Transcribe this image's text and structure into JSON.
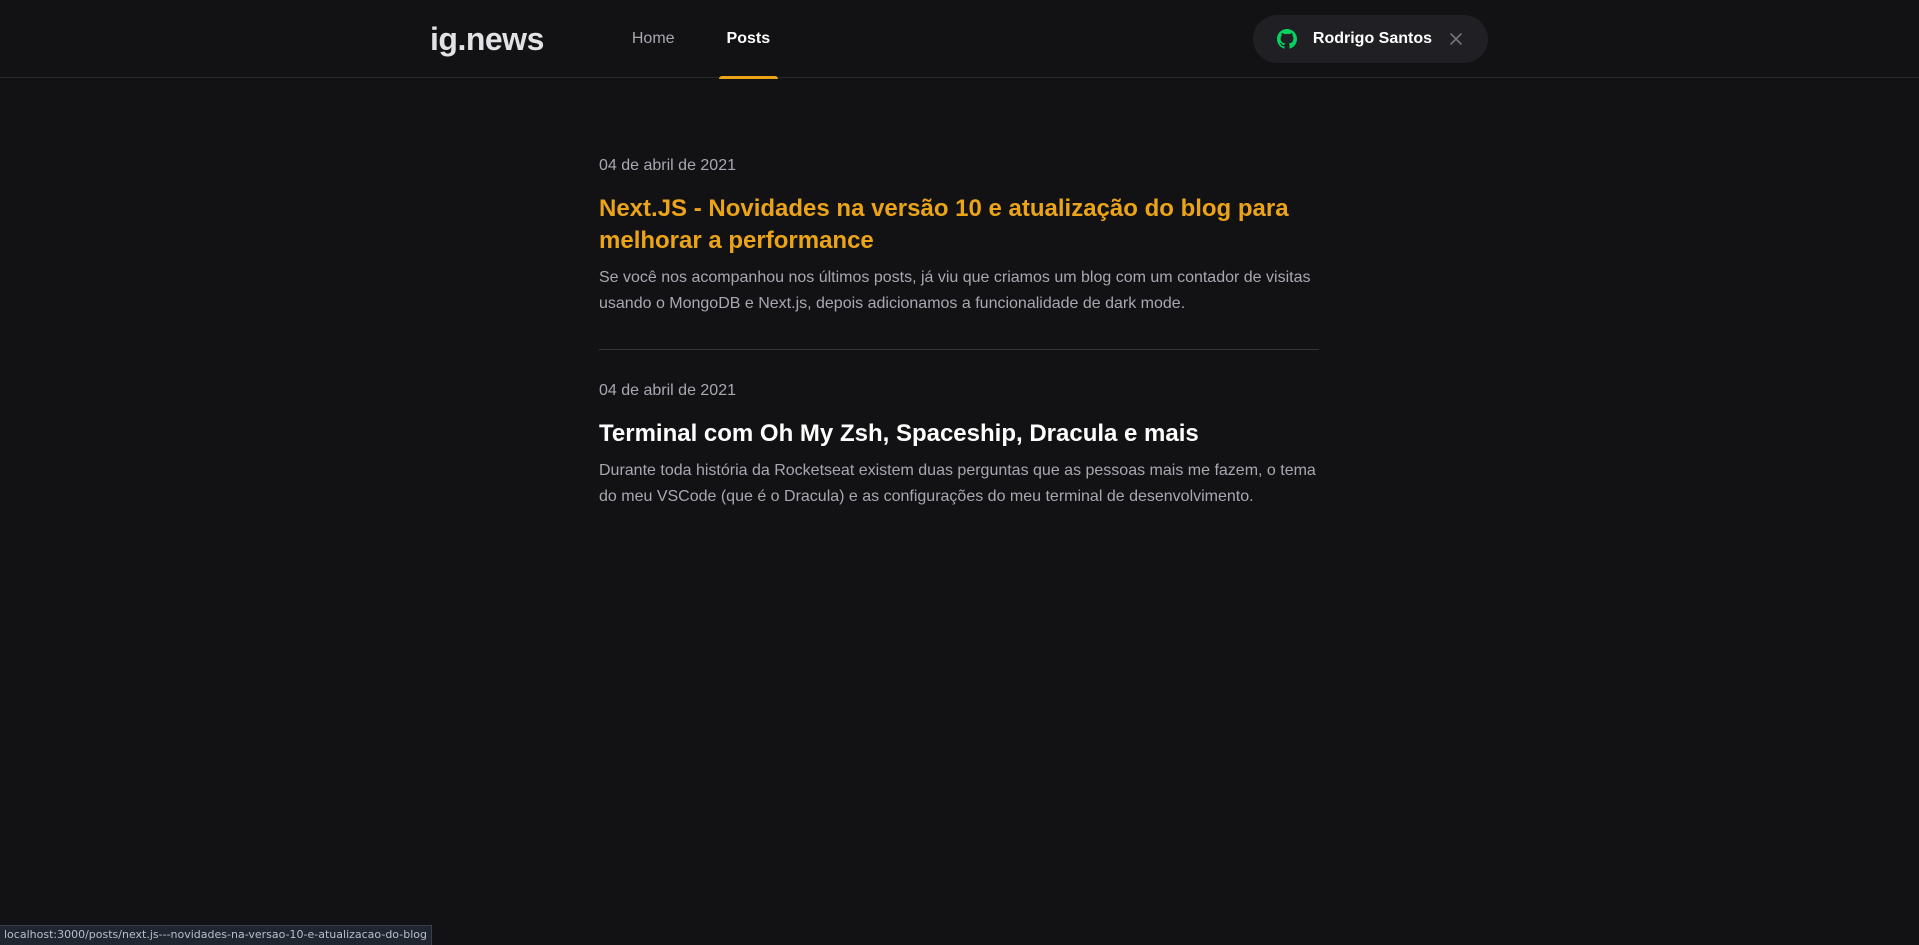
{
  "header": {
    "logo": "ig.news",
    "nav": [
      {
        "label": "Home",
        "active": false
      },
      {
        "label": "Posts",
        "active": true
      }
    ],
    "signin": {
      "icon": "github-icon",
      "user_name": "Rodrigo Santos",
      "close_icon": "close-icon"
    }
  },
  "posts": [
    {
      "date": "04 de abril de 2021",
      "title": "Next.JS - Novidades na versão 10 e atualização do blog para melhorar a performance",
      "excerpt": "Se você nos acompanhou nos últimos posts, já viu que criamos um blog com um contador de visitas usando o MongoDB e Next.js, depois adicionamos a funcionalidade de dark mode.",
      "hovered": true
    },
    {
      "date": "04 de abril de 2021",
      "title": "Terminal com Oh My Zsh, Spaceship, Dracula e mais",
      "excerpt": "Durante toda história da Rocketseat existem duas perguntas que as pessoas mais me fazem, o tema do meu VSCode (que é o Dracula) e as configurações do meu terminal de desenvolvimento.",
      "hovered": false
    }
  ],
  "status_bar": {
    "url": "localhost:3000/posts/next.js---novidades-na-versao-10-e-atualizacao-do-blog"
  },
  "colors": {
    "background": "#121214",
    "accent": "#eba417",
    "github_green": "#04d361"
  }
}
